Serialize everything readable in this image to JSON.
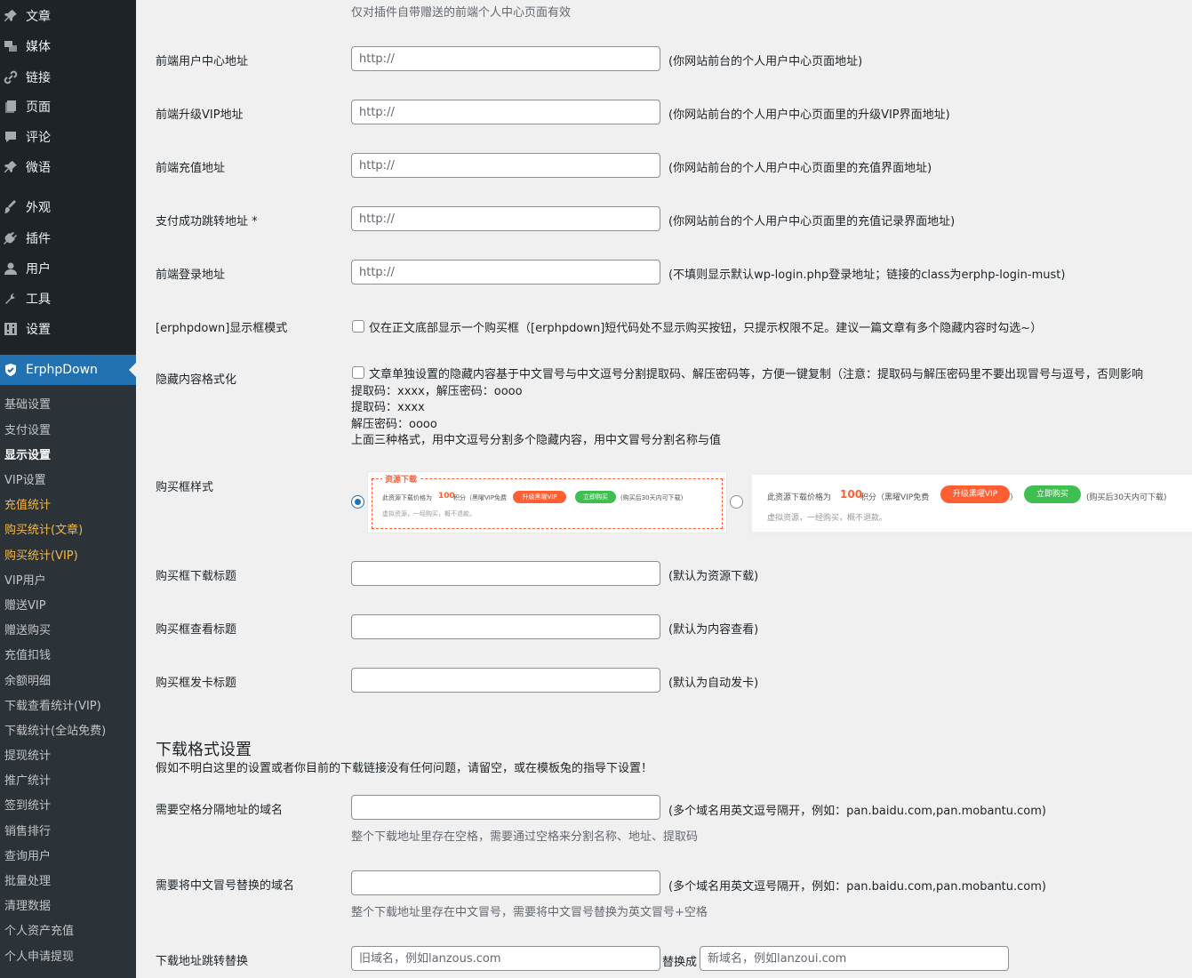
{
  "sidebar": {
    "menu": [
      {
        "label": "文章",
        "icon": "pushpin-icon"
      },
      {
        "label": "媒体",
        "icon": "media-icon"
      },
      {
        "label": "链接",
        "icon": "link-icon"
      },
      {
        "label": "页面",
        "icon": "page-icon"
      },
      {
        "label": "评论",
        "icon": "comment-icon"
      },
      {
        "label": "微语",
        "icon": "pushpin-icon"
      },
      {
        "label": "外观",
        "icon": "brush-icon"
      },
      {
        "label": "插件",
        "icon": "plugin-icon"
      },
      {
        "label": "用户",
        "icon": "user-icon"
      },
      {
        "label": "工具",
        "icon": "wrench-icon"
      },
      {
        "label": "设置",
        "icon": "settings-icon"
      }
    ],
    "current": {
      "label": "ErphpDown",
      "icon": "shield-icon"
    },
    "submenu": [
      "基础设置",
      "支付设置",
      "显示设置",
      "VIP设置",
      "充值统计",
      "购买统计(文章)",
      "购买统计(VIP)",
      "VIP用户",
      "赠送VIP",
      "赠送购买",
      "充值扣钱",
      "余额明细",
      "下载查看统计(VIP)",
      "下载统计(全站免费)",
      "提现统计",
      "推广统计",
      "签到统计",
      "销售排行",
      "查询用户",
      "批量处理",
      "清理数据",
      "个人资产充值",
      "个人申请提现"
    ],
    "colors": {
      "bg": "#1d2327",
      "submenu_bg": "#2c3338",
      "current": "#2271b1",
      "highlight": "#f0b849"
    }
  },
  "top_note": "仅对插件自带赠送的前端个人中心页面有效",
  "url_fields": [
    {
      "label": "前端用户中心地址",
      "placeholder": "http://",
      "hint": "(你网站前台的个人用户中心页面地址)"
    },
    {
      "label": "前端升级VIP地址",
      "placeholder": "http://",
      "hint": "(你网站前台的个人用户中心页面里的升级VIP界面地址)"
    },
    {
      "label": "前端充值地址",
      "placeholder": "http://",
      "hint": "(你网站前台的个人用户中心页面里的充值界面地址)"
    },
    {
      "label": "支付成功跳转地址 *",
      "placeholder": "http://",
      "hint": "(你网站前台的个人用户中心页面里的充值记录界面地址)"
    },
    {
      "label": "前端登录地址",
      "placeholder": "http://",
      "hint": "(不填则显示默认wp-login.php登录地址；链接的class为erphp-login-must)"
    }
  ],
  "display_mode": {
    "label": "[erphpdown]显示框模式",
    "text": "仅在正文底部显示一个购买框（[erphpdown]短代码处不显示购买按钮，只提示权限不足。建议一篇文章有多个隐藏内容时勾选~）"
  },
  "hidden_format": {
    "label": "隐藏内容格式化",
    "text": "文章单独设置的隐藏内容基于中文冒号与中文逗号分割提取码、解压密码等，方便一键复制（注意：提取码与解压密码里不要出现冒号与逗号，否则影响",
    "lines": [
      "提取码：xxxx，解压密码：oooo",
      "提取码：xxxx",
      "解压密码：oooo",
      "上面三种格式，用中文逗号分割多个隐藏内容，用中文冒号分割名称与值"
    ]
  },
  "box_style": {
    "label": "购买框样式",
    "selected": 1,
    "style1": {
      "title": "资源下载",
      "text": "此资源下载价格为",
      "price": "100",
      "unit": "积分（黑曜VIP免费",
      "upgrade": "升级黑曜VIP",
      "buy": "立即购买",
      "after": "(购买后30天内可下载)",
      "note": "虚拟资源，一经购买，概不退款。"
    },
    "style2": {
      "text": "此资源下载价格为",
      "price": "100",
      "unit": "积分（黑曜VIP免费",
      "upgrade": "升级黑曜VIP",
      "close": "）",
      "buy": "立即购买",
      "after": "(购买后30天内可下载)",
      "note": "虚拟资源，一经购买，概不退款。"
    }
  },
  "title_fields": [
    {
      "label": "购买框下载标题",
      "value": "",
      "hint": "(默认为资源下载)"
    },
    {
      "label": "购买框查看标题",
      "value": "",
      "hint": "(默认为内容查看)"
    },
    {
      "label": "购买框发卡标题",
      "value": "",
      "hint": "(默认为自动发卡)"
    }
  ],
  "download_section": {
    "title": "下载格式设置",
    "desc": "假如不明白这里的设置或者你目前的下载链接没有任何问题，请留空，或在模板兔的指导下设置！",
    "space_domains": {
      "label": "需要空格分隔地址的域名",
      "hint": "(多个域名用英文逗号隔开，例如：pan.baidu.com,pan.mobantu.com)",
      "desc": "整个下载地址里存在空格，需要通过空格来分割名称、地址、提取码"
    },
    "colon_domains": {
      "label": "需要将中文冒号替换的域名",
      "hint": "(多个域名用英文逗号隔开，例如：pan.baidu.com,pan.mobantu.com)",
      "desc": "整个下载地址里存在中文冒号，需要将中文冒号替换为英文冒号+空格"
    },
    "redirect": {
      "label": "下载地址跳转替换",
      "old_placeholder": "旧域名，例如lanzous.com",
      "join": "替换成",
      "new_placeholder": "新域名，例如lanzoui.com"
    }
  }
}
